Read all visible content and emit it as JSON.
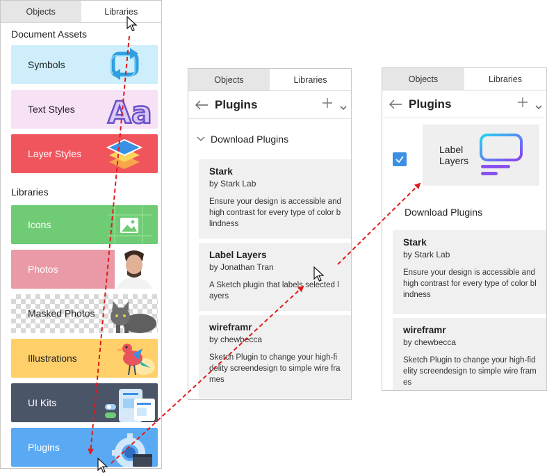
{
  "panel1": {
    "tabs": [
      "Objects",
      "Libraries"
    ],
    "document_assets_heading": "Document Assets",
    "libraries_heading": "Libraries",
    "assets": [
      {
        "label": "Symbols",
        "color": "#cdeefa"
      },
      {
        "label": "Text Styles",
        "color": "#f7e1f5"
      },
      {
        "label": "Layer Styles",
        "color": "#f0555e"
      }
    ],
    "libraries": [
      {
        "label": "Icons",
        "color": "#6fcc74"
      },
      {
        "label": "Photos",
        "color": "#e99aa6"
      },
      {
        "label": "Masked Photos",
        "color": "checker"
      },
      {
        "label": "Illustrations",
        "color": "#ffd06a"
      },
      {
        "label": "UI Kits",
        "color": "#4b5568"
      },
      {
        "label": "Plugins",
        "color": "#5aaaf3"
      }
    ]
  },
  "panel2": {
    "tabs": [
      "Objects",
      "Libraries"
    ],
    "title": "Plugins",
    "section": "Download Plugins",
    "plugins": [
      {
        "name": "Stark",
        "by": "by Stark Lab",
        "desc": "Ensure your design is accessible and high contrast for every type of color blindness"
      },
      {
        "name": "Label Layers",
        "by": "by Jonathan Tran",
        "desc": "A Sketch plugin that labels selected layers"
      },
      {
        "name": "wireframr",
        "by": "by chewbecca",
        "desc": "Sketch Plugin to change your high-fidelity screendesign to simple wire frames"
      }
    ]
  },
  "panel3": {
    "tabs": [
      "Objects",
      "Libraries"
    ],
    "title": "Plugins",
    "installed": {
      "label": "Label Layers",
      "checked": true
    },
    "section": "Download Plugins",
    "plugins": [
      {
        "name": "Stark",
        "by": "by Stark Lab",
        "desc": "Ensure your design is accessible and high contrast for every type of color blindness"
      },
      {
        "name": "wireframr",
        "by": "by chewbecca",
        "desc": "Sketch Plugin to change your high-fidelity screendesign to simple wire frames"
      }
    ]
  },
  "colors": {
    "accent": "#3b8fe4",
    "arrow": "#e01b1b"
  }
}
